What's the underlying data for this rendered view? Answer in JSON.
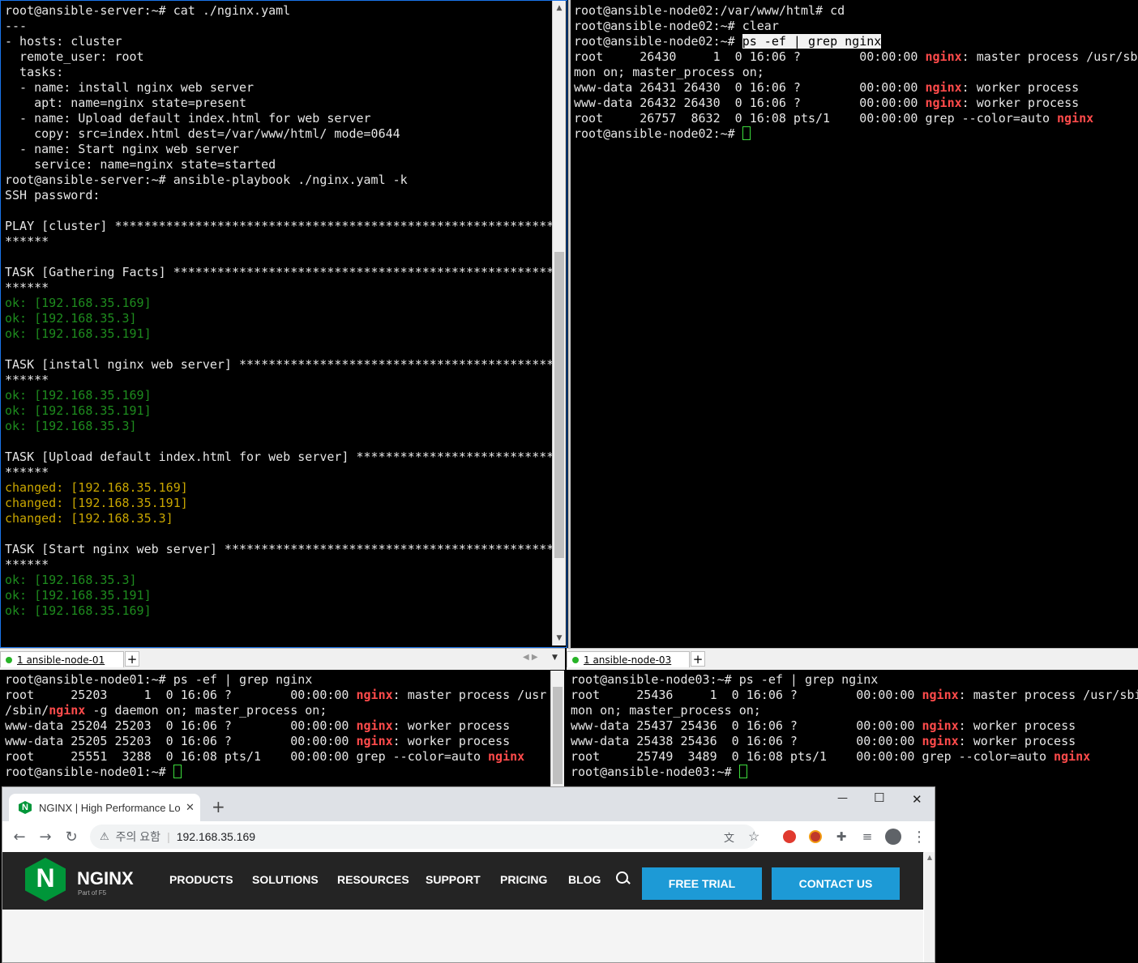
{
  "terminals": {
    "server": {
      "lines": [
        [
          {
            "t": "root@ansible-server:~# cat ./nginx.yaml"
          }
        ],
        [
          {
            "t": "---"
          }
        ],
        [
          {
            "t": "- hosts: cluster"
          }
        ],
        [
          {
            "t": "  remote_user: root"
          }
        ],
        [
          {
            "t": "  tasks:"
          }
        ],
        [
          {
            "t": "  - name: install nginx web server"
          }
        ],
        [
          {
            "t": "    apt: name=nginx state=present"
          }
        ],
        [
          {
            "t": "  - name: Upload default index.html for web server"
          }
        ],
        [
          {
            "t": "    copy: src=index.html dest=/var/www/html/ mode=0644"
          }
        ],
        [
          {
            "t": "  - name: Start nginx web server"
          }
        ],
        [
          {
            "t": "    service: name=nginx state=started"
          }
        ],
        [
          {
            "t": "root@ansible-server:~# ansible-playbook ./nginx.yaml -k"
          }
        ],
        [
          {
            "t": "SSH password:"
          }
        ],
        [
          {
            "t": ""
          }
        ],
        [
          {
            "t": "PLAY [cluster] ************************************************************"
          }
        ],
        [
          {
            "t": "******"
          }
        ],
        [
          {
            "t": ""
          }
        ],
        [
          {
            "t": "TASK [Gathering Facts] ****************************************************"
          }
        ],
        [
          {
            "t": "******"
          }
        ],
        [
          {
            "t": "ok: [192.168.35.169]",
            "c": "ok"
          }
        ],
        [
          {
            "t": "ok: [192.168.35.3]",
            "c": "ok"
          }
        ],
        [
          {
            "t": "ok: [192.168.35.191]",
            "c": "ok"
          }
        ],
        [
          {
            "t": ""
          }
        ],
        [
          {
            "t": "TASK [install nginx web server] *******************************************"
          }
        ],
        [
          {
            "t": "******"
          }
        ],
        [
          {
            "t": "ok: [192.168.35.169]",
            "c": "ok"
          }
        ],
        [
          {
            "t": "ok: [192.168.35.191]",
            "c": "ok"
          }
        ],
        [
          {
            "t": "ok: [192.168.35.3]",
            "c": "ok"
          }
        ],
        [
          {
            "t": ""
          }
        ],
        [
          {
            "t": "TASK [Upload default index.html for web server] ***************************"
          }
        ],
        [
          {
            "t": "******"
          }
        ],
        [
          {
            "t": "changed: [192.168.35.169]",
            "c": "chg"
          }
        ],
        [
          {
            "t": "changed: [192.168.35.191]",
            "c": "chg"
          }
        ],
        [
          {
            "t": "changed: [192.168.35.3]",
            "c": "chg"
          }
        ],
        [
          {
            "t": ""
          }
        ],
        [
          {
            "t": "TASK [Start nginx web server] *********************************************"
          }
        ],
        [
          {
            "t": "******"
          }
        ],
        [
          {
            "t": "ok: [192.168.35.3]",
            "c": "ok"
          }
        ],
        [
          {
            "t": "ok: [192.168.35.191]",
            "c": "ok"
          }
        ],
        [
          {
            "t": "ok: [192.168.35.169]",
            "c": "ok"
          }
        ]
      ]
    },
    "node02": {
      "lines": [
        [
          {
            "t": "root@ansible-node02:/var/www/html# cd"
          }
        ],
        [
          {
            "t": "root@ansible-node02:~# clear"
          }
        ],
        [
          {
            "t": "root@ansible-node02:~# "
          },
          {
            "t": "ps -ef | grep nginx",
            "c": "sel"
          }
        ],
        [
          {
            "t": "root     26430     1  0 16:06 ?        00:00:00 "
          },
          {
            "t": "nginx",
            "c": "hl"
          },
          {
            "t": ": master process /usr/sbi"
          }
        ],
        [
          {
            "t": "mon on; master_process on;"
          }
        ],
        [
          {
            "t": "www-data 26431 26430  0 16:06 ?        00:00:00 "
          },
          {
            "t": "nginx",
            "c": "hl"
          },
          {
            "t": ": worker process"
          }
        ],
        [
          {
            "t": "www-data 26432 26430  0 16:06 ?        00:00:00 "
          },
          {
            "t": "nginx",
            "c": "hl"
          },
          {
            "t": ": worker process"
          }
        ],
        [
          {
            "t": "root     26757  8632  0 16:08 pts/1    00:00:00 grep --color=auto "
          },
          {
            "t": "nginx",
            "c": "hl"
          }
        ],
        [
          {
            "t": "root@ansible-node02:~# "
          },
          {
            "cursor": true
          }
        ]
      ]
    },
    "node01": {
      "tab_label": "1 ansible-node-01",
      "lines": [
        [
          {
            "t": "root@ansible-node01:~# ps -ef | grep nginx"
          }
        ],
        [
          {
            "t": "root     25203     1  0 16:06 ?        00:00:00 "
          },
          {
            "t": "nginx",
            "c": "hl"
          },
          {
            "t": ": master process /usr"
          }
        ],
        [
          {
            "t": "/sbin/"
          },
          {
            "t": "nginx",
            "c": "hl"
          },
          {
            "t": " -g daemon on; master_process on;"
          }
        ],
        [
          {
            "t": "www-data 25204 25203  0 16:06 ?        00:00:00 "
          },
          {
            "t": "nginx",
            "c": "hl"
          },
          {
            "t": ": worker process"
          }
        ],
        [
          {
            "t": "www-data 25205 25203  0 16:06 ?        00:00:00 "
          },
          {
            "t": "nginx",
            "c": "hl"
          },
          {
            "t": ": worker process"
          }
        ],
        [
          {
            "t": "root     25551  3288  0 16:08 pts/1    00:00:00 grep --color=auto "
          },
          {
            "t": "nginx",
            "c": "hl"
          }
        ],
        [
          {
            "t": "root@ansible-node01:~# "
          },
          {
            "cursor": true
          }
        ]
      ]
    },
    "node03": {
      "tab_label": "1 ansible-node-03",
      "lines": [
        [
          {
            "t": "root@ansible-node03:~# ps -ef | grep nginx"
          }
        ],
        [
          {
            "t": "root     25436     1  0 16:06 ?        00:00:00 "
          },
          {
            "t": "nginx",
            "c": "hl"
          },
          {
            "t": ": master process /usr/sbi"
          }
        ],
        [
          {
            "t": "mon on; master_process on;"
          }
        ],
        [
          {
            "t": "www-data 25437 25436  0 16:06 ?        00:00:00 "
          },
          {
            "t": "nginx",
            "c": "hl"
          },
          {
            "t": ": worker process"
          }
        ],
        [
          {
            "t": "www-data 25438 25436  0 16:06 ?        00:00:00 "
          },
          {
            "t": "nginx",
            "c": "hl"
          },
          {
            "t": ": worker process"
          }
        ],
        [
          {
            "t": "root     25749  3489  0 16:08 pts/1    00:00:00 grep --color=auto "
          },
          {
            "t": "nginx",
            "c": "hl"
          }
        ],
        [
          {
            "t": "root@ansible-node03:~# "
          },
          {
            "cursor": true
          }
        ]
      ]
    }
  },
  "browser": {
    "tab_title": "NGINX | High Performance Loa",
    "security_label": "주의 요함",
    "url": "192.168.35.169",
    "window_controls": {
      "minimize": "—",
      "maximize": "☐",
      "close": "✕"
    }
  },
  "site": {
    "logo_letter": "N",
    "logo_text": "NGINX",
    "logo_sub": "Part of F5",
    "nav": [
      "PRODUCTS",
      "SOLUTIONS",
      "RESOURCES",
      "SUPPORT",
      "PRICING",
      "BLOG"
    ],
    "free_trial": "FREE TRIAL",
    "contact_us": "CONTACT US"
  },
  "colors": {
    "accent": "#1d9ad6",
    "nginx_green": "#009639",
    "ok": "#1e8c1e",
    "changed": "#c9a600",
    "highlight": "#ff4b4b"
  }
}
